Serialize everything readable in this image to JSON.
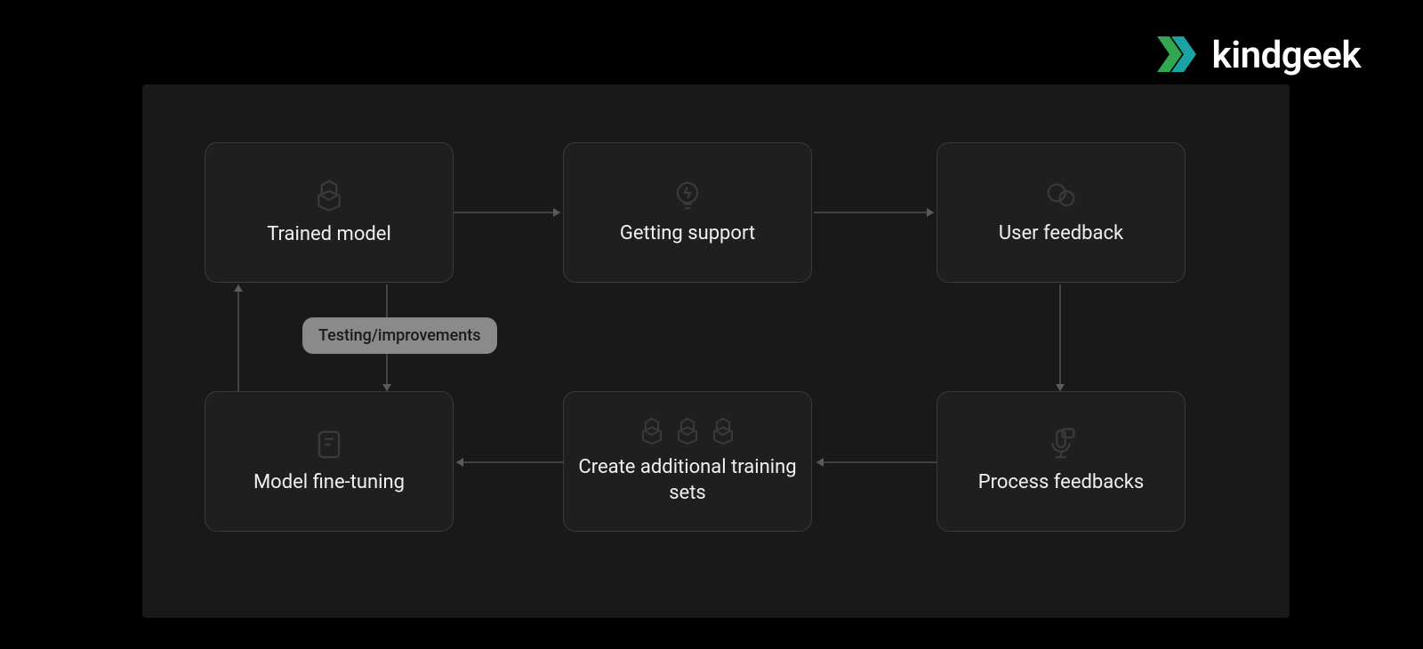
{
  "brand": {
    "name": "kindgeek"
  },
  "nodes": {
    "trained_model": {
      "label": "Trained model",
      "icon": "openai"
    },
    "getting_support": {
      "label": "Getting support",
      "icon": "bulb"
    },
    "user_feedback": {
      "label": "User feedback",
      "icon": "chat"
    },
    "process_feedbacks": {
      "label": "Process feedbacks",
      "icon": "mic"
    },
    "create_sets": {
      "label": "Create additional training sets",
      "icon": "openai-x3"
    },
    "fine_tuning": {
      "label": "Model fine-tuning",
      "icon": "book"
    }
  },
  "edge_label": {
    "testing": "Testing/improvements"
  },
  "flow_edges": [
    "trained_model -> getting_support",
    "getting_support -> user_feedback",
    "user_feedback -> process_feedbacks",
    "process_feedbacks -> create_sets",
    "create_sets -> fine_tuning",
    "fine_tuning <-> trained_model (Testing/improvements)"
  ]
}
